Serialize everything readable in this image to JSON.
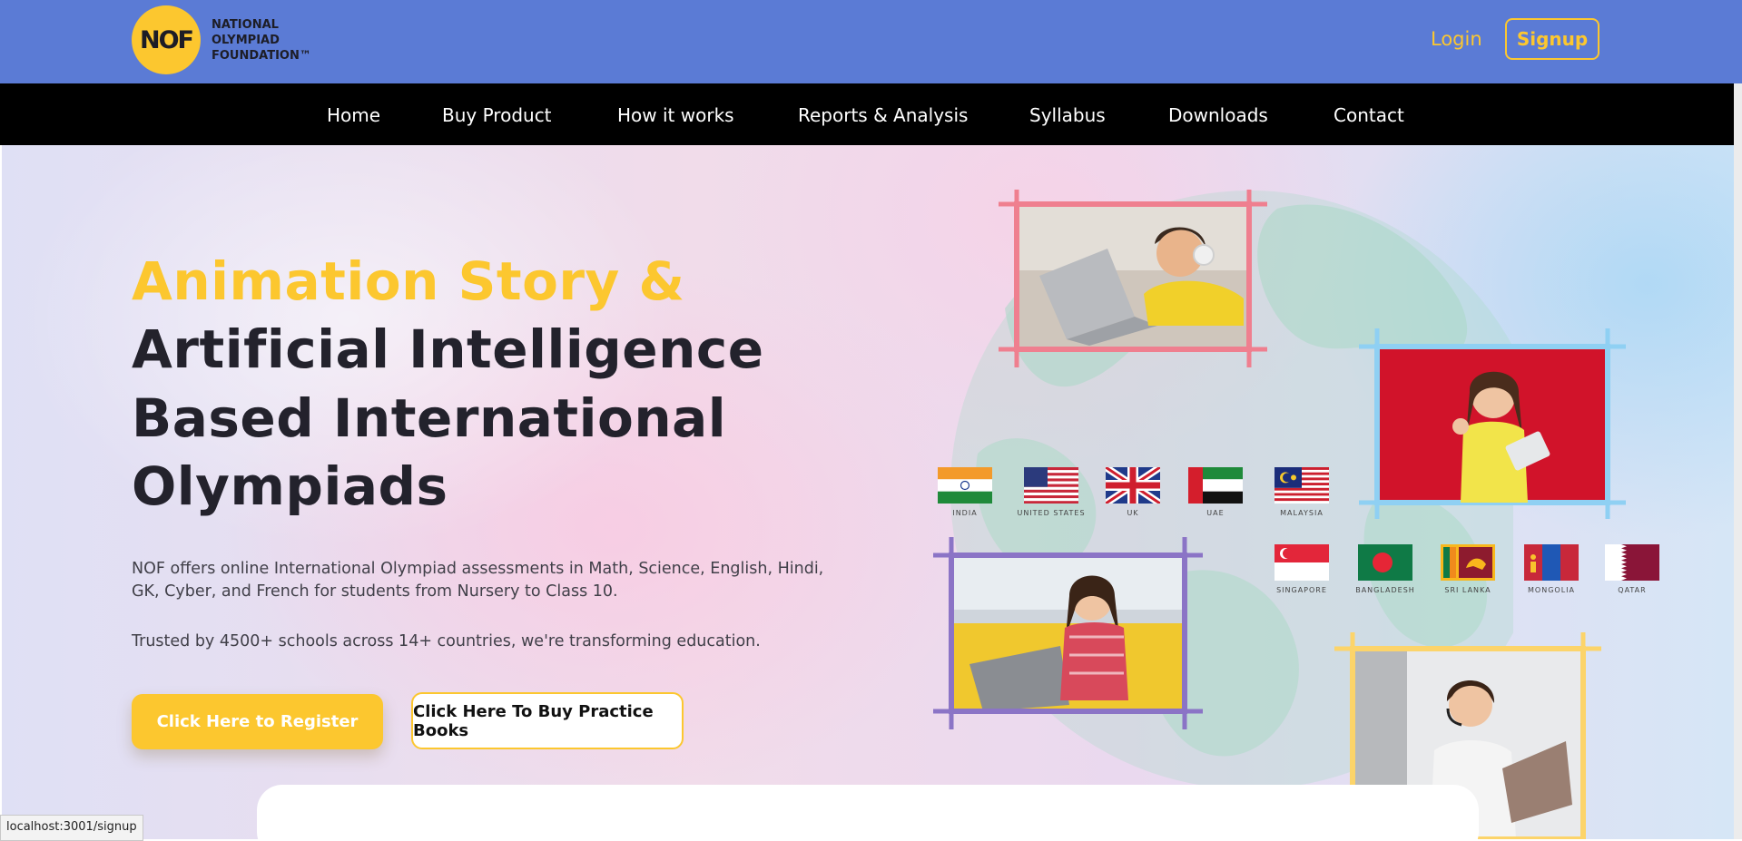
{
  "header": {
    "logo_mark": "NOF",
    "logo_lines": [
      "NATIONAL",
      "OLYMPIAD",
      "FOUNDATION™"
    ],
    "login_label": "Login",
    "signup_label": "Signup"
  },
  "nav": {
    "items": [
      "Home",
      "Buy Product",
      "How it works",
      "Reports & Analysis",
      "Syllabus",
      "Downloads",
      "Contact"
    ]
  },
  "hero": {
    "title_line1": "Animation Story &",
    "title_line2": "Artificial Intelligence",
    "title_line3": "Based International",
    "title_line4": "Olympiads",
    "description": "NOF offers online International Olympiad assessments in Math, Science, English, Hindi, GK, Cyber, and French for students from Nursery to Class 10.",
    "trusted": "Trusted by 4500+ schools across 14+ countries, we're transforming education.",
    "register_button": "Click Here to Register",
    "books_button": "Click Here To Buy Practice Books"
  },
  "flags": [
    {
      "label": "INDIA",
      "icon": "india-flag"
    },
    {
      "label": "UNITED STATES",
      "icon": "usa-flag"
    },
    {
      "label": "UK",
      "icon": "uk-flag"
    },
    {
      "label": "UAE",
      "icon": "uae-flag"
    },
    {
      "label": "MALAYSIA",
      "icon": "malaysia-flag"
    },
    {
      "label": "SINGAPORE",
      "icon": "singapore-flag"
    },
    {
      "label": "BANGLADESH",
      "icon": "bangladesh-flag"
    },
    {
      "label": "SRI LANKA",
      "icon": "srilanka-flag"
    },
    {
      "label": "MONGOLIA",
      "icon": "mongolia-flag"
    },
    {
      "label": "QATAR",
      "icon": "qatar-flag"
    }
  ],
  "colors": {
    "header_bg": "#5b7bd5",
    "nav_bg": "#000000",
    "accent_yellow": "#fcc72f",
    "heading_dark": "#23222c",
    "frame_pink": "#ef7f8f",
    "frame_blue": "#8fd0f3",
    "frame_purple": "#8b74c6",
    "frame_yellow": "#fcd46a"
  },
  "status_bar": {
    "url": "localhost:3001/signup"
  }
}
